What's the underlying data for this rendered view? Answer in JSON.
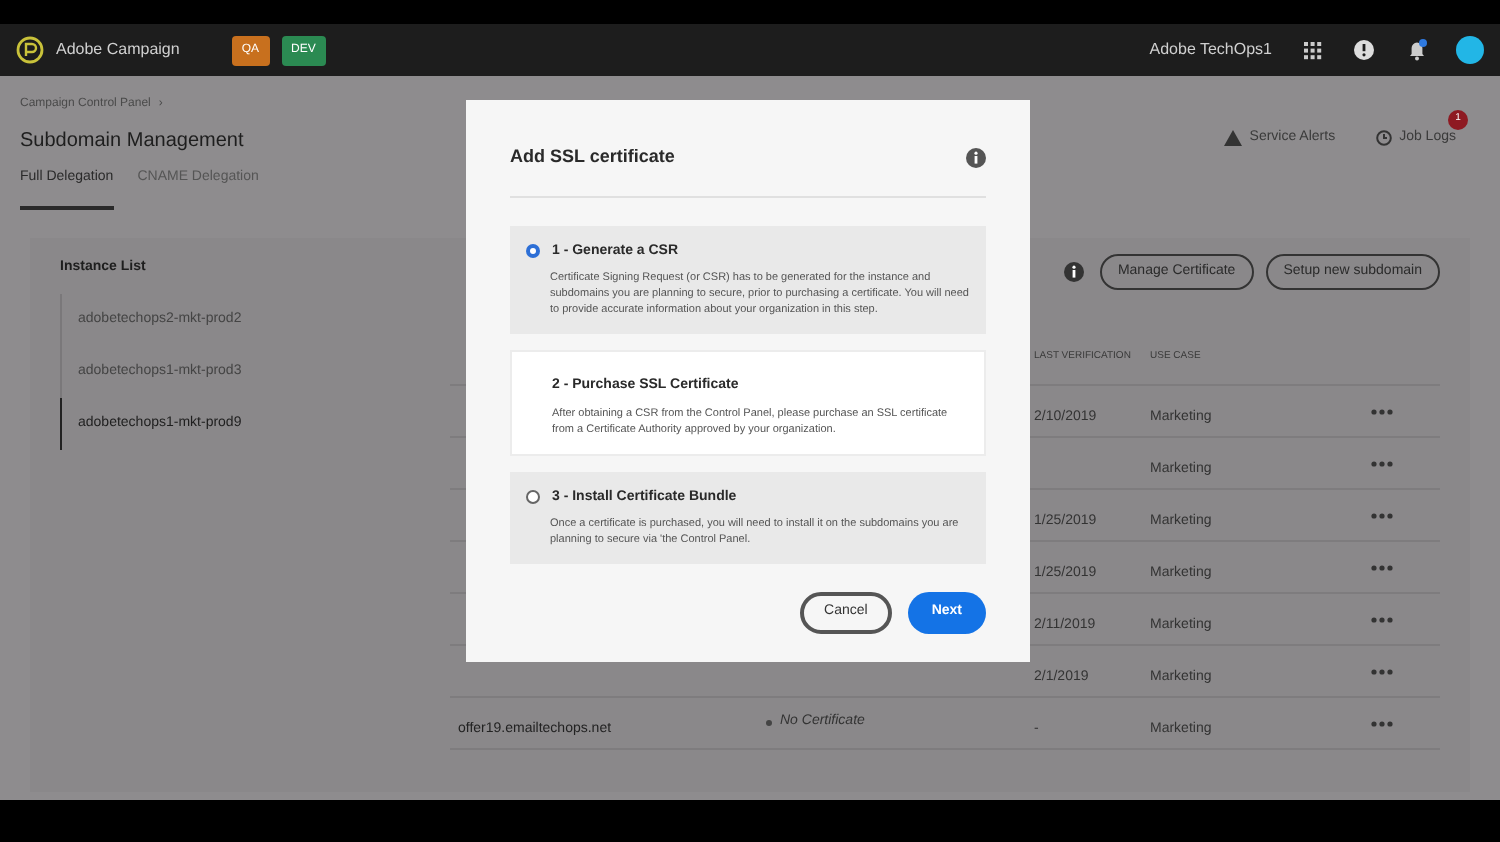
{
  "topbar": {
    "product": "Adobe Campaign",
    "env_badges": [
      {
        "label": "QA",
        "color": "#c8701e"
      },
      {
        "label": "DEV",
        "color": "#2b8a52"
      }
    ],
    "org": "Adobe TechOps1"
  },
  "page": {
    "breadcrumb": "Campaign Control Panel",
    "breadcrumb_separator": "›",
    "title": "Subdomain Management",
    "tabs": [
      {
        "label": "Full Delegation",
        "selected": true
      },
      {
        "label": "CNAME Delegation",
        "selected": false
      }
    ],
    "service_alerts": "Service Alerts",
    "job_logs": {
      "label": "Job Logs",
      "badge": "1"
    }
  },
  "instance_list": {
    "title": "Instance List",
    "items": [
      {
        "label": "adobetechops2-mkt-prod2",
        "selected": false
      },
      {
        "label": "adobetechops1-mkt-prod3",
        "selected": false
      },
      {
        "label": "adobetechops1-mkt-prod9",
        "selected": true
      }
    ]
  },
  "toolbar": {
    "buttons": [
      "Manage Certificate",
      "Setup new subdomain"
    ]
  },
  "table": {
    "columns": [
      "LAST VERIFICATION",
      "USE CASE"
    ],
    "rows": [
      {
        "last_verification": "2/10/2019",
        "use_case": "Marketing"
      },
      {
        "use_case": "Marketing"
      },
      {
        "last_verification": "1/25/2019",
        "use_case": "Marketing"
      },
      {
        "last_verification": "1/25/2019",
        "use_case": "Marketing"
      },
      {
        "last_verification": "2/11/2019",
        "use_case": "Marketing"
      },
      {
        "last_verification": "2/1/2019",
        "use_case": "Marketing"
      },
      {
        "domain": "offer19.emailtechops.net",
        "certificate": "No Certificate",
        "last_verification": "-",
        "use_case": "Marketing"
      }
    ]
  },
  "modal": {
    "title": "Add SSL certificate",
    "steps": [
      {
        "kind": "radio",
        "selected": true,
        "title": "1 - Generate a CSR",
        "description": "Certificate Signing Request (or CSR) has to be generated for the instance and subdomains you are planning to secure, prior to purchasing a certificate. You will need to provide accurate information about your organization in this step."
      },
      {
        "kind": "plain",
        "title": "2 - Purchase SSL Certificate",
        "description": "After obtaining a CSR from the Control Panel, please purchase an SSL certificate from a Certificate Authority approved by your organization."
      },
      {
        "kind": "radio",
        "selected": false,
        "title": "3 - Install Certificate Bundle",
        "description": "Once a certificate is purchased, you will need to install it on the subdomains you are planning to secure via 'the Control Panel."
      }
    ],
    "buttons": {
      "cancel": "Cancel",
      "next": "Next"
    }
  }
}
